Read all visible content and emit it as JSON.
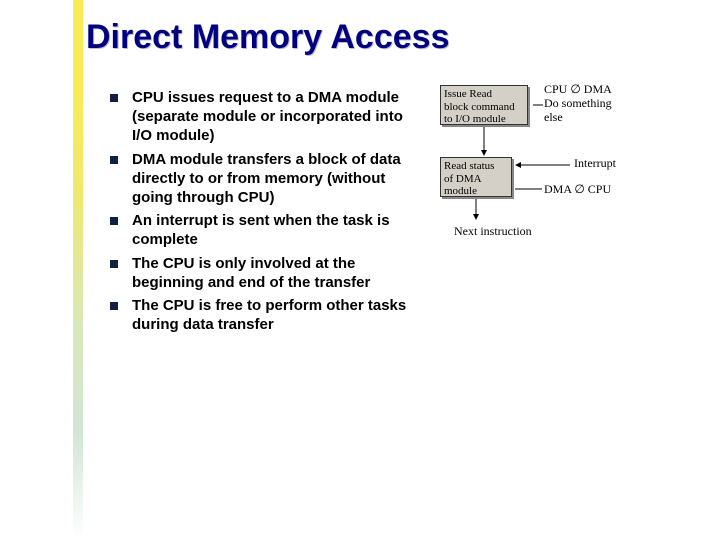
{
  "title": "Direct Memory Access",
  "bullets": [
    "CPU issues request to a DMA module (separate module or incorporated into I/O module)",
    "DMA module transfers a block of data directly to or from memory (without going through CPU)",
    "An interrupt is sent when the task is complete",
    "The CPU is only involved at the beginning and end of the transfer",
    "The CPU is free to perform other tasks during data transfer"
  ],
  "diagram": {
    "box1": "Issue Read\nblock command\nto I/O module",
    "label1": "CPU ∅ DMA\nDo something\nelse",
    "box2": "Read status\nof DMA\nmodule",
    "label2": "Interrupt",
    "label3": "DMA ∅ CPU",
    "label4": "Next instruction"
  }
}
